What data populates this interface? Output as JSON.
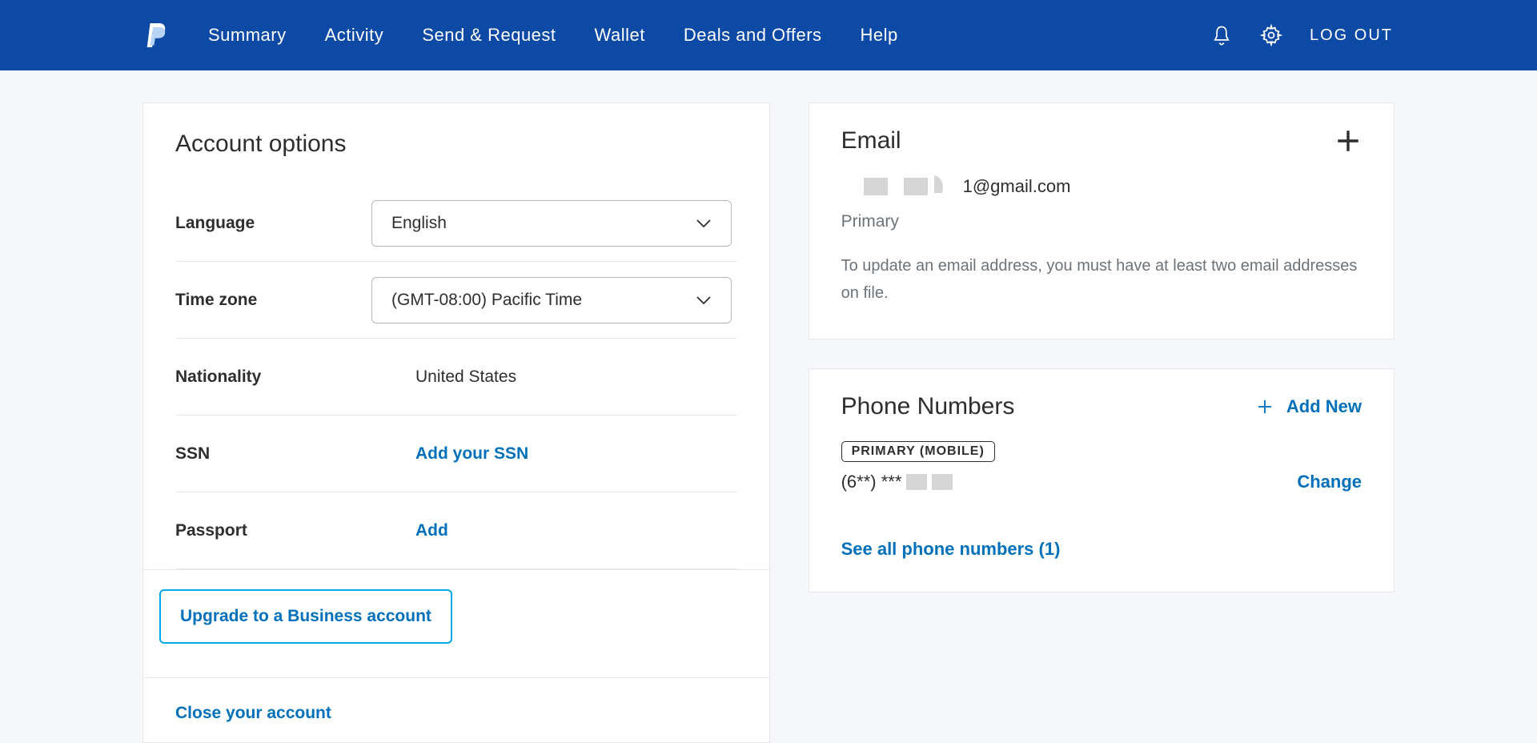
{
  "header": {
    "nav": [
      "Summary",
      "Activity",
      "Send & Request",
      "Wallet",
      "Deals and Offers",
      "Help"
    ],
    "logout": "LOG OUT"
  },
  "account_options": {
    "title": "Account options",
    "language": {
      "label": "Language",
      "value": "English"
    },
    "timezone": {
      "label": "Time zone",
      "value": "(GMT-08:00) Pacific Time"
    },
    "nationality": {
      "label": "Nationality",
      "value": "United States"
    },
    "ssn": {
      "label": "SSN",
      "link": "Add your SSN"
    },
    "passport": {
      "label": "Passport",
      "link": "Add"
    },
    "upgrade": "Upgrade to a Business account",
    "close": "Close your account"
  },
  "email": {
    "title": "Email",
    "address_suffix": "1@gmail.com",
    "primary": "Primary",
    "hint": "To update an email address, you must have at least two email addresses on file."
  },
  "phone": {
    "title": "Phone Numbers",
    "add_new": "Add New",
    "badge": "PRIMARY (MOBILE)",
    "number_prefix": "(6**) ***",
    "change": "Change",
    "see_all": "See all phone numbers (1)"
  }
}
